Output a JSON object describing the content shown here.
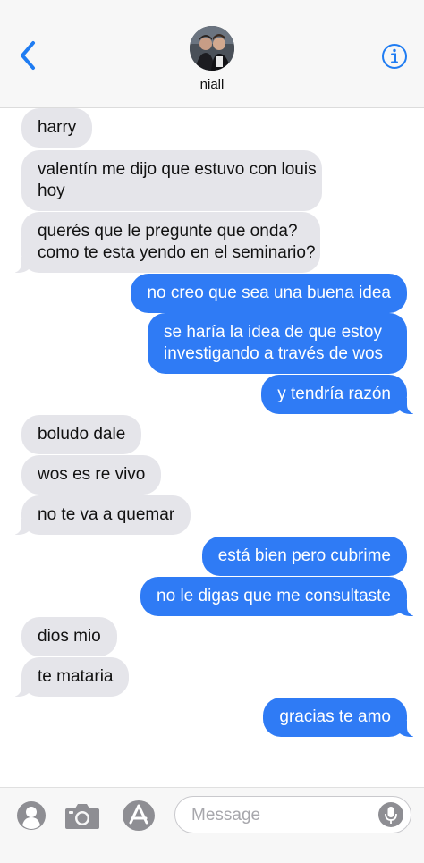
{
  "header": {
    "contact_name": "niall"
  },
  "messages": [
    {
      "side": "in",
      "text": "harry"
    },
    {
      "side": "in",
      "lines": [
        "valentín me dijo que estuvo con louis",
        "hoy"
      ]
    },
    {
      "side": "in",
      "lines": [
        "querés que le pregunte que onda?",
        "como te esta yendo en el seminario?"
      ]
    },
    {
      "side": "out",
      "text": "no creo que sea una buena idea"
    },
    {
      "side": "out",
      "lines": [
        "se haría la idea de que estoy",
        "investigando a través de wos"
      ]
    },
    {
      "side": "out",
      "text": "y tendría razón"
    },
    {
      "side": "in",
      "text": "boludo dale"
    },
    {
      "side": "in",
      "text": "wos es re vivo"
    },
    {
      "side": "in",
      "text": "no te va a quemar"
    },
    {
      "side": "out",
      "text": "está bien pero cubrime"
    },
    {
      "side": "out",
      "text": "no le digas que me consultaste"
    },
    {
      "side": "in",
      "text": "dios mio"
    },
    {
      "side": "in",
      "text": "te mataria"
    },
    {
      "side": "out",
      "text": "gracias te amo"
    }
  ],
  "input_bar": {
    "placeholder": "Message"
  },
  "colors": {
    "outgoing_bubble": "#2f7bf5",
    "incoming_bubble": "#e5e5ea",
    "accent": "#1f7cf2"
  },
  "icons": {
    "back": "chevron-left-icon",
    "info": "info-icon",
    "contacts": "person-icon",
    "camera": "camera-icon",
    "app_store": "app-store-icon",
    "mic": "microphone-icon"
  }
}
